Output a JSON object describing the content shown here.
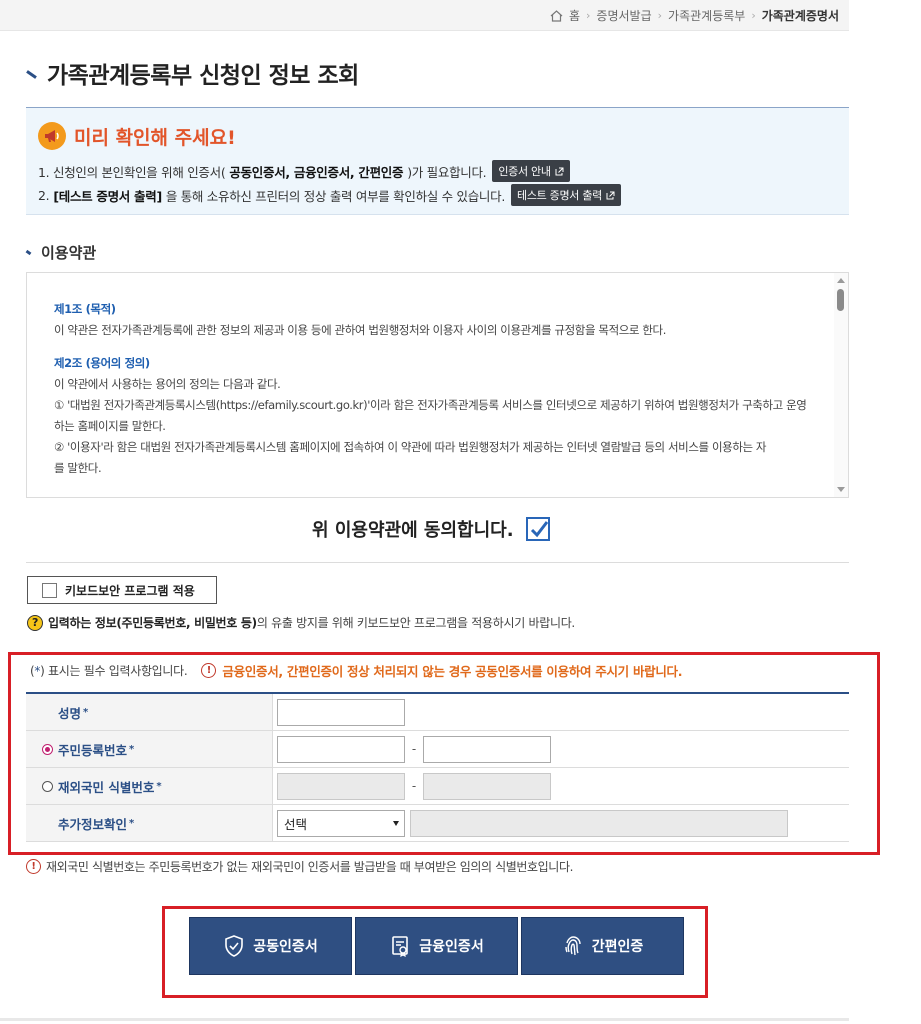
{
  "breadcrumb": {
    "home": "홈",
    "items": [
      "증명서발급",
      "가족관계등록부"
    ],
    "current": "가족관계증명서"
  },
  "page_title": "가족관계등록부 신청인 정보 조회",
  "notice": {
    "title": "미리 확인해 주세요!",
    "line1_prefix": "1. 신청인의 본인확인을 위해 인증서(",
    "line1_bold": "공동인증서, 금융인증서, 간편인증",
    "line1_suffix": ")가 필요합니다.",
    "line1_button": "인증서 안내",
    "line2_prefix": "2.",
    "line2_bold": "[테스트 증명서 출력]",
    "line2_suffix": "을 통해 소유하신 프린터의 정상 출력 여부를 확인하실 수 있습니다.",
    "line2_button": "테스트 증명서 출력"
  },
  "terms": {
    "section_title": "이용약관",
    "art1_title": "제1조 (목적)",
    "art1_text": "이 약관은 전자가족관계등록에 관한 정보의 제공과 이용 등에 관하여 법원행정처와 이용자 사이의 이용관계를 규정함을 목적으로 한다.",
    "art2_title": "제2조 (용어의 정의)",
    "art2_text": "이 약관에서 사용하는 용어의 정의는 다음과 같다.",
    "art2_item1a": "① '대법원 전자가족관계등록시스템(https://efamily.scourt.go.kr)'이라 함은 전자가족관계등록 서비스를 인터넷으로 제공하기 위하여 법원행정처가 구축하고 운영",
    "art2_item1b": "하는 홈페이지를 말한다.",
    "art2_item2a": "② '이용자'라 함은 대법원 전자가족관계등록시스템 홈페이지에 접속하여 이 약관에 따라 법원행정처가 제공하는 인터넷 열람발급 등의 서비스를 이용하는 자",
    "art2_item2b": "를 말한다.",
    "agree_label": "위 이용약관에 동의합니다."
  },
  "keyboard": {
    "button_label": "키보드보안 프로그램 적용",
    "note_bold": "입력하는 정보(주민등록번호, 비밀번호 등)",
    "note_rest": "의 유출 방지를 위해 키보드보안 프로그램을 적용하시기 바랍니다."
  },
  "form": {
    "required_prefix": "(",
    "required_star": "*",
    "required_suffix": ") 표시는 필수 입력사항입니다.",
    "warning": "금융인증서, 간편인증이 정상 처리되지 않는 경우 공동인증서를 이용하여 주시기 바랍니다.",
    "name_label": "성명",
    "rrn_label": "주민등록번호",
    "foreign_label": "재외국민 식별번호",
    "extra_label": "추가정보확인",
    "star": "*",
    "dash": "-",
    "select_value": "선택"
  },
  "foot_note": "재외국민 식별번호는 주민등록번호가 없는 재외국민이 인증서를 발급받을 때 부여받은 임의의 식별번호입니다.",
  "auth_buttons": {
    "joint": "공동인증서",
    "financial": "금융인증서",
    "simple": "간편인증"
  },
  "colors": {
    "primary": "#2f4f82",
    "accent_red": "#d81f26",
    "warning_orange": "#e0691b",
    "notice_bg": "#eef6fc"
  }
}
